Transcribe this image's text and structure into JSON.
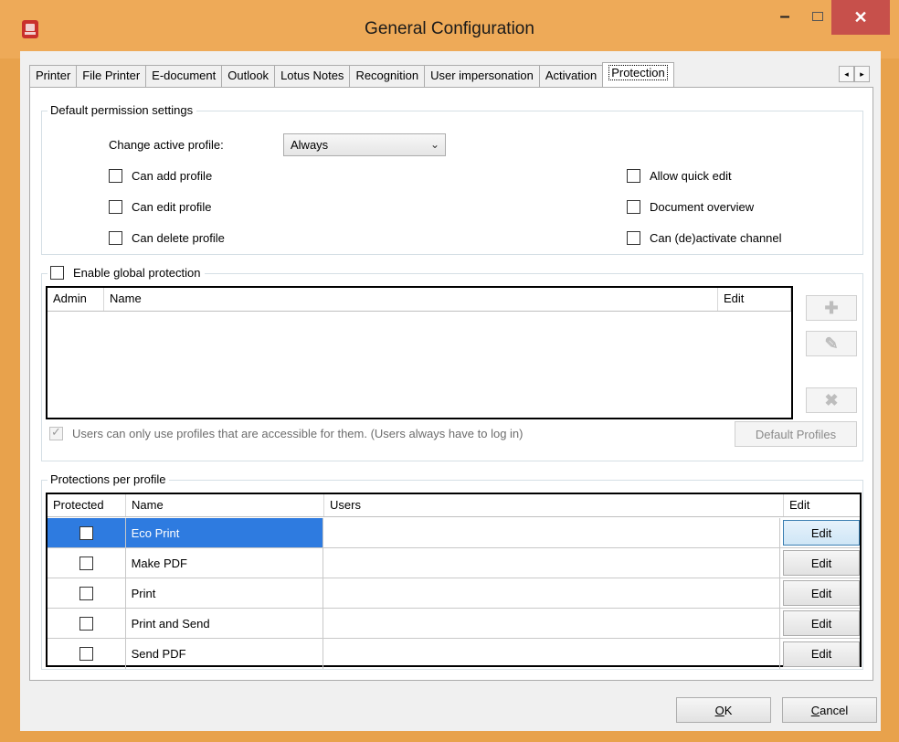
{
  "window": {
    "title": "General Configuration",
    "minimize_glyph": "–",
    "close_glyph": "✕"
  },
  "tabs": [
    {
      "label": "Printer"
    },
    {
      "label": "File Printer"
    },
    {
      "label": "E-document"
    },
    {
      "label": "Outlook"
    },
    {
      "label": "Lotus Notes"
    },
    {
      "label": "Recognition"
    },
    {
      "label": "User impersonation"
    },
    {
      "label": "Activation"
    },
    {
      "label": "Protection",
      "active": true
    }
  ],
  "tab_scroll": {
    "left": "◂",
    "right": "▸"
  },
  "default_permissions": {
    "legend": "Default permission settings",
    "change_profile_label": "Change active profile:",
    "change_profile_value": "Always",
    "checkboxes_left": [
      "Can add profile",
      "Can edit profile",
      "Can delete profile"
    ],
    "checkboxes_right": [
      "Allow quick edit",
      "Document overview",
      "Can (de)activate channel"
    ]
  },
  "global_protection": {
    "legend": "Enable global protection",
    "columns": [
      "Admin",
      "Name",
      "Edit"
    ],
    "rows": [],
    "add_icon": "✚",
    "edit_icon": "✎",
    "delete_icon": "✖",
    "users_only_label": "Users can only use profiles that are accessible for them. (Users always have to log in)",
    "users_only_checked": true,
    "default_profiles_button": "Default Profiles"
  },
  "protections_per_profile": {
    "legend": "Protections per profile",
    "columns": [
      "Protected",
      "Name",
      "Users",
      "Edit"
    ],
    "rows": [
      {
        "protected": false,
        "name": "Eco Print",
        "users": "",
        "edit": "Edit",
        "selected": true
      },
      {
        "protected": false,
        "name": "Make PDF",
        "users": "",
        "edit": "Edit"
      },
      {
        "protected": false,
        "name": "Print",
        "users": "",
        "edit": "Edit"
      },
      {
        "protected": false,
        "name": "Print and Send",
        "users": "",
        "edit": "Edit"
      },
      {
        "protected": false,
        "name": "Send PDF",
        "users": "",
        "edit": "Edit"
      }
    ]
  },
  "footer": {
    "ok_label": "OK",
    "ok_accel": "O",
    "ok_rest": "K",
    "cancel_label": "Cancel",
    "cancel_accel": "C",
    "cancel_rest": "ancel"
  },
  "colors": {
    "titlebar": "#eeaa58",
    "close_button": "#c7504b",
    "selection": "#2e7be0"
  }
}
